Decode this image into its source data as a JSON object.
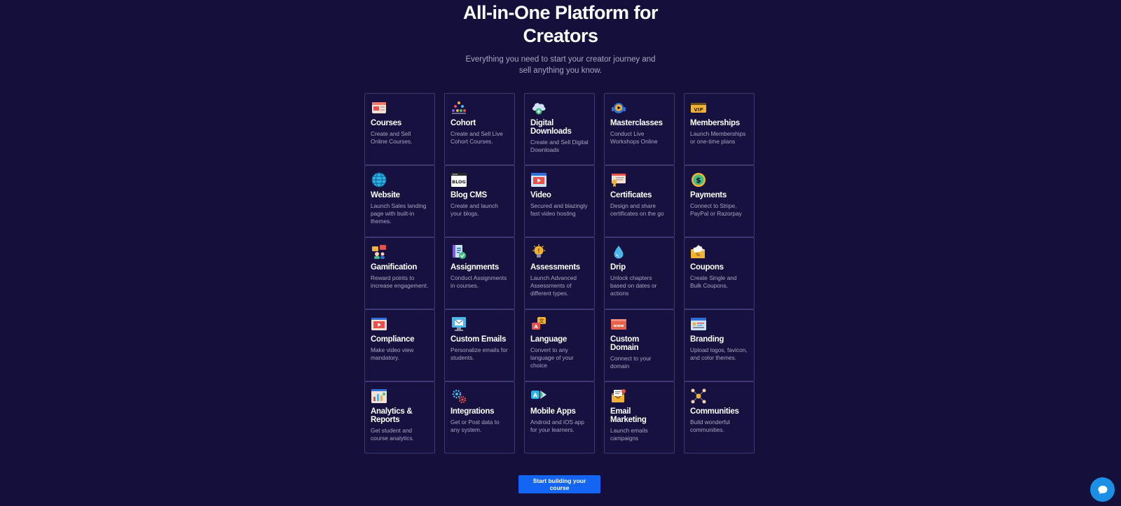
{
  "hero": {
    "title": "All-in-One Platform for Creators",
    "subtitle": "Everything you need to start your creator journey and sell anything you know."
  },
  "features": [
    {
      "title": "Courses",
      "desc": "Create and Sell Online Courses.",
      "icon": "courses-icon"
    },
    {
      "title": "Cohort",
      "desc": "Create and Sell Live Cohort Courses.",
      "icon": "cohort-icon"
    },
    {
      "title": "Digital Downloads",
      "desc": "Create and Sell Digital Downloads",
      "icon": "cloud-download-icon"
    },
    {
      "title": "Masterclasses",
      "desc": "Conduct Live Workshops Online",
      "icon": "play-headset-icon"
    },
    {
      "title": "Memberships",
      "desc": "Launch Memberships or one-time plans",
      "icon": "vip-ticket-icon"
    },
    {
      "title": "Website",
      "desc": "Launch Sales landing page with built-in themes.",
      "icon": "globe-icon"
    },
    {
      "title": "Blog CMS",
      "desc": "Create and launch your blogs.",
      "icon": "blog-window-icon"
    },
    {
      "title": "Video",
      "desc": "Secured and blazingly fast video hosting",
      "icon": "video-window-icon"
    },
    {
      "title": "Certificates",
      "desc": "Design and share certificates on the go",
      "icon": "certificate-icon"
    },
    {
      "title": "Payments",
      "desc": "Connect to Stripe, PayPal or Razorpay",
      "icon": "dollar-coin-icon"
    },
    {
      "title": "Gamification",
      "desc": "Reward points to increase engagement.",
      "icon": "gamification-icon"
    },
    {
      "title": "Assignments",
      "desc": "Conduct Assignments in courses.",
      "icon": "assignment-icon"
    },
    {
      "title": "Assessments",
      "desc": "Launch Advanced Assessments of different types.",
      "icon": "lightbulb-icon"
    },
    {
      "title": "Drip",
      "desc": "Unlock chapters based on dates or actions",
      "icon": "water-drop-icon"
    },
    {
      "title": "Coupons",
      "desc": "Create Single and Bulk Coupons.",
      "icon": "coupon-icon"
    },
    {
      "title": "Compliance",
      "desc": "Make video view mandatory.",
      "icon": "video-compliance-icon"
    },
    {
      "title": "Custom Emails",
      "desc": "Personalize emails for students.",
      "icon": "email-monitor-icon"
    },
    {
      "title": "Language",
      "desc": "Convert to any language of your choice",
      "icon": "translate-icon"
    },
    {
      "title": "Custom Domain",
      "desc": "Connect to your domain",
      "icon": "www-domain-icon"
    },
    {
      "title": "Branding",
      "desc": "Upload logos, favicon, and color themes.",
      "icon": "branding-card-icon"
    },
    {
      "title": "Analytics & Reports",
      "desc": "Get student and course analytics.",
      "icon": "analytics-chart-icon"
    },
    {
      "title": "Integrations",
      "desc": "Get or Post data to any system.",
      "icon": "gears-icon"
    },
    {
      "title": "Mobile Apps",
      "desc": "Android and iOS app for your learners.",
      "icon": "app-store-icon"
    },
    {
      "title": "Email Marketing",
      "desc": "Launch emails campaigns",
      "icon": "envelope-icon"
    },
    {
      "title": "Communities",
      "desc": "Build wonderful communities.",
      "icon": "community-network-icon"
    }
  ],
  "cta": {
    "label": "Start building your course"
  },
  "chat": {
    "icon": "chat-bubble-icon"
  }
}
